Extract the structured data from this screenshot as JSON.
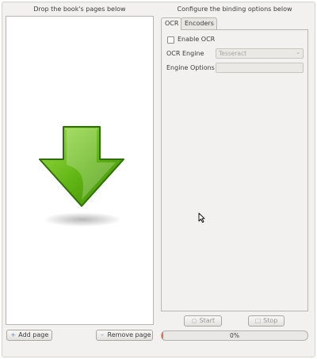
{
  "left_panel": {
    "title": "Drop the book's pages below",
    "drop_icon": "download-arrow-icon",
    "buttons": {
      "add": {
        "label": "Add page",
        "icon": "plus-icon"
      },
      "remove": {
        "label": "Remove page",
        "icon": "minus-icon"
      }
    }
  },
  "right_panel": {
    "title": "Configure the binding options below",
    "tabs": [
      {
        "label": "OCR",
        "active": true
      },
      {
        "label": "Encoders",
        "active": false
      }
    ],
    "ocr": {
      "enable_label": "Enable OCR",
      "enable_checked": false,
      "engine_label": "OCR Engine",
      "engine_value": "Tesseract",
      "options_label": "Engine Options",
      "options_value": ""
    },
    "buttons": {
      "start": {
        "label": "Start",
        "icon": "play-icon",
        "enabled": false
      },
      "stop": {
        "label": "Stop",
        "icon": "stop-icon",
        "enabled": false
      }
    },
    "progress": {
      "text": "0%",
      "fraction": 0
    }
  },
  "colors": {
    "arrow_green": "#5fb313",
    "arrow_dark": "#2f6f05",
    "progress_accent": "#e2683a"
  }
}
